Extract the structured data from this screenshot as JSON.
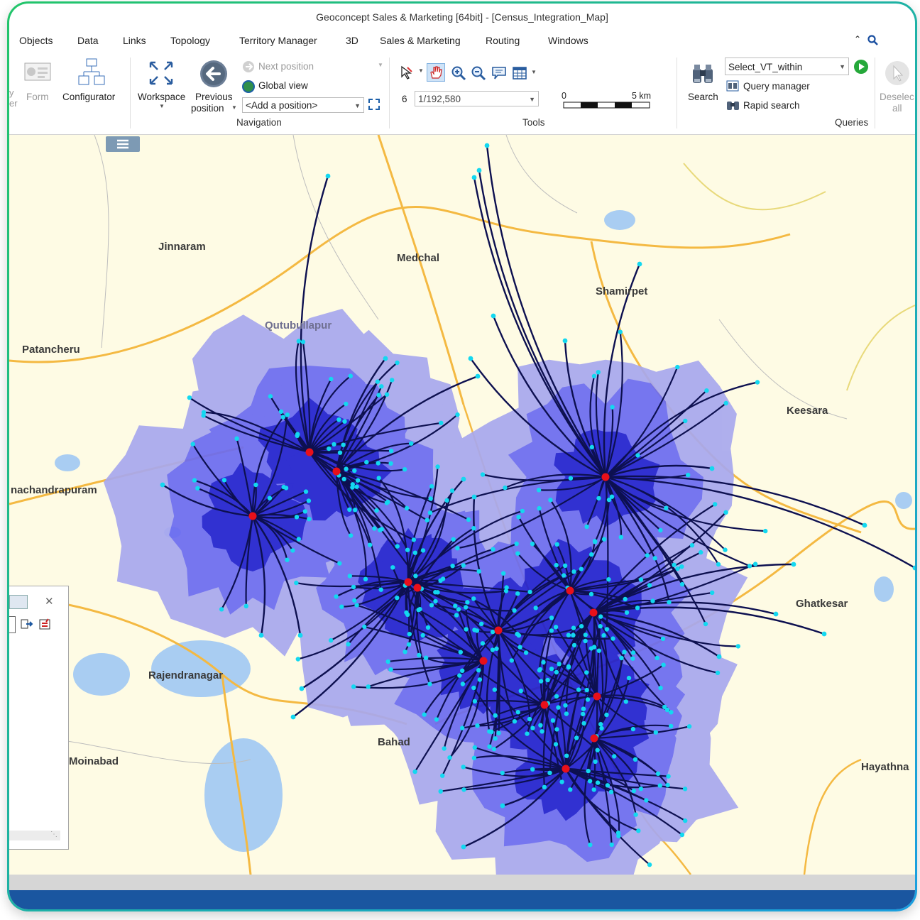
{
  "window": {
    "title": "Geoconcept Sales & Marketing [64bit] - [Census_Integration_Map]"
  },
  "menu": [
    "Objects",
    "Data",
    "Links",
    "Topology",
    "Territory Manager",
    "3D",
    "Sales & Marketing",
    "Routing",
    "Windows"
  ],
  "ribbon": {
    "form_label": "Form",
    "configurator_label": "Configurator",
    "workspace_label": "Workspace",
    "previous_label_1": "Previous",
    "previous_label_2": "position",
    "next_position": "Next position",
    "global_view": "Global view",
    "add_position": "<Add a position>",
    "navigation_group": "Navigation",
    "tools_group": "Tools",
    "scale_level": "6",
    "scale_value": "1/192,580",
    "scalebar_min": "0",
    "scalebar_max": "5 km",
    "search_label": "Search",
    "query_select": "Select_VT_within",
    "query_manager": "Query manager",
    "rapid_search": "Rapid search",
    "queries_group": "Queries",
    "deselect_1": "Deselec",
    "deselect_2": "all"
  },
  "places": [
    {
      "name": "Jinnaram"
    },
    {
      "name": "Medchal"
    },
    {
      "name": "Shamirpet"
    },
    {
      "name": "Qutubullapur"
    },
    {
      "name": "Patancheru"
    },
    {
      "name": "Keesara"
    },
    {
      "name": "nachandrapuram"
    },
    {
      "name": "Ghatkesar"
    },
    {
      "name": "Rajendranagar"
    },
    {
      "name": "Bahad"
    },
    {
      "name": "Moinabad"
    },
    {
      "name": "Hayathna"
    }
  ],
  "colors": {
    "hub": "#e8101a",
    "spoke": "#0d1050",
    "endpoint": "#13d8f0",
    "zone_dark": "#2020d0",
    "zone_mid": "#6b6bf0",
    "zone_light": "#a8a8ee",
    "road": "#f4b942",
    "water": "#a9cdf2",
    "land": "#fefbe4"
  }
}
